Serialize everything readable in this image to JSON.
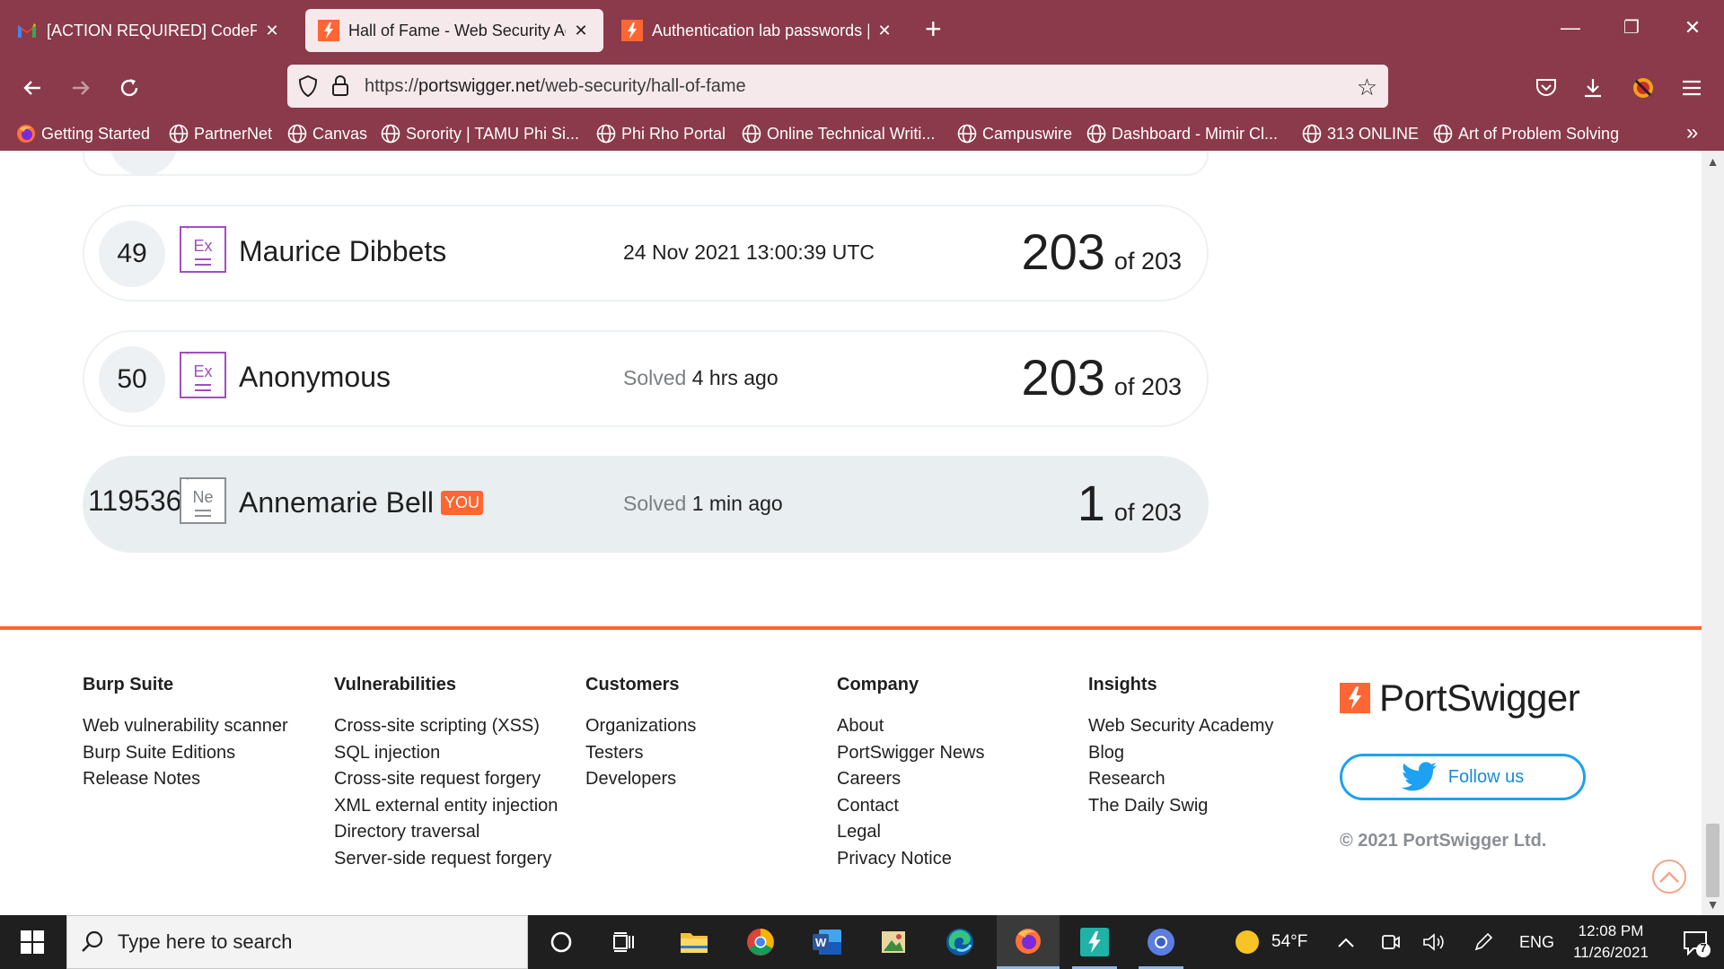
{
  "browser": {
    "tabs": [
      {
        "label": "[ACTION REQUIRED] CodePath",
        "icon": "gmail-icon",
        "active": false
      },
      {
        "label": "Hall of Fame - Web Security Aca",
        "icon": "portswigger-icon",
        "active": true
      },
      {
        "label": "Authentication lab passwords | ",
        "icon": "portswigger-icon",
        "active": false
      }
    ],
    "url": {
      "scheme": "https://",
      "host": "portswigger.net",
      "path": "/web-security/hall-of-fame"
    },
    "bookmarks": [
      {
        "label": "Getting Started",
        "icon": "firefox-icon"
      },
      {
        "label": "PartnerNet",
        "icon": "globe-icon"
      },
      {
        "label": "Canvas",
        "icon": "globe-icon"
      },
      {
        "label": "Sorority | TAMU Phi Si...",
        "icon": "globe-icon"
      },
      {
        "label": "Phi Rho Portal",
        "icon": "globe-icon"
      },
      {
        "label": "Online Technical Writi...",
        "icon": "globe-icon"
      },
      {
        "label": "Campuswire",
        "icon": "globe-icon"
      },
      {
        "label": "Dashboard - Mimir Cl...",
        "icon": "globe-icon"
      },
      {
        "label": "313 ONLINE",
        "icon": "globe-icon"
      },
      {
        "label": "Art of Problem Solving",
        "icon": "globe-icon"
      }
    ]
  },
  "leaderboard": [
    {
      "rank": "49",
      "badge": "Ex",
      "name": "Maurice Dibbets",
      "when_label": "",
      "when_value": "24 Nov 2021 13:00:39 UTC",
      "solved": "203",
      "of_total": "of 203",
      "is_you": false
    },
    {
      "rank": "50",
      "badge": "Ex",
      "name": "Anonymous",
      "when_label": "Solved",
      "when_value": "4 hrs ago",
      "solved": "203",
      "of_total": "of 203",
      "is_you": false
    },
    {
      "rank": "119536",
      "badge": "Ne",
      "name": "Annemarie Bell",
      "you_tag": "YOU",
      "when_label": "Solved",
      "when_value": "1 min ago",
      "solved": "1",
      "of_total": "of 203",
      "is_you": true
    }
  ],
  "footer": {
    "columns": [
      {
        "heading": "Burp Suite",
        "links": [
          "Web vulnerability scanner",
          "Burp Suite Editions",
          "Release Notes"
        ]
      },
      {
        "heading": "Vulnerabilities",
        "links": [
          "Cross-site scripting (XSS)",
          "SQL injection",
          "Cross-site request forgery",
          "XML external entity injection",
          "Directory traversal",
          "Server-side request forgery"
        ]
      },
      {
        "heading": "Customers",
        "links": [
          "Organizations",
          "Testers",
          "Developers"
        ]
      },
      {
        "heading": "Company",
        "links": [
          "About",
          "PortSwigger News",
          "Careers",
          "Contact",
          "Legal",
          "Privacy Notice"
        ]
      },
      {
        "heading": "Insights",
        "links": [
          "Web Security Academy",
          "Blog",
          "Research",
          "The Daily Swig"
        ]
      }
    ],
    "brand": "PortSwigger",
    "follow_label": "Follow us",
    "copyright": "© 2021 PortSwigger Ltd."
  },
  "taskbar": {
    "search_placeholder": "Type here to search",
    "weather": "54°F",
    "language": "ENG",
    "time": "12:08 PM",
    "date": "11/26/2021",
    "notification_count": "7"
  },
  "colors": {
    "chrome": "#8a3a4a",
    "accent": "#ff6633",
    "expert_badge": "#a14fbf",
    "twitter": "#1da1f2"
  }
}
